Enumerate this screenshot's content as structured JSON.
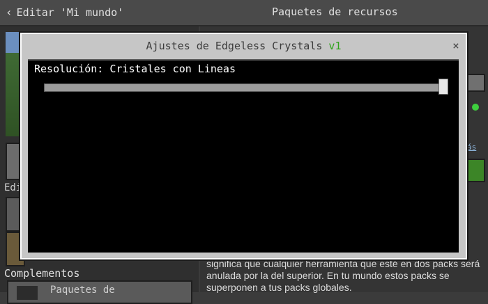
{
  "header": {
    "back_label": "Editar 'Mi mundo'",
    "page_title": "Paquetes de recursos"
  },
  "left_panel": {
    "edit_label": "Edi",
    "addons_label": "Complementos",
    "item_label": "Paquetes de"
  },
  "right_panel": {
    "link_label": "ás",
    "info_text": "significa que cualquier herramienta que esté en dos packs será anulada por la del superior. En tu mundo estos packs se superponen a tus packs globales."
  },
  "modal": {
    "title": "Ajustes de Edgeless Crystals",
    "version": "v1",
    "close_label": "×",
    "setting_label": "Resolución: Cristales con Lineas",
    "slider_level": 1.0
  },
  "colors": {
    "version_green": "#2fa31b",
    "status_dot": "#3ecf3e"
  },
  "icons": [
    "chevron-left-icon",
    "close-icon"
  ]
}
